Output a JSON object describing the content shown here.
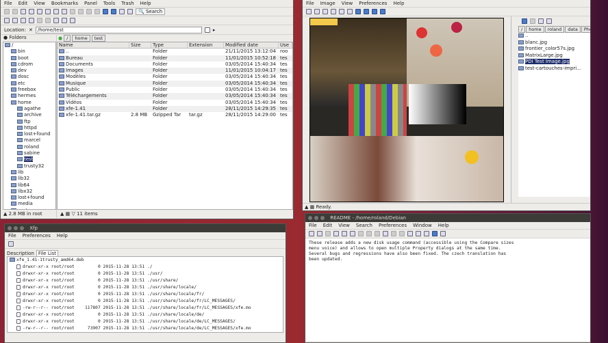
{
  "xfe": {
    "menu": [
      "File",
      "Edit",
      "View",
      "Bookmarks",
      "Panel",
      "Tools",
      "Trash",
      "Help"
    ],
    "search_label": "Search",
    "location_label": "Location:",
    "location_value": "/home/test",
    "folders_label": "Folders",
    "breadcrumb": [
      "/",
      "home",
      "test"
    ],
    "columns": [
      "Name",
      "Size",
      "Type",
      "Extension",
      "Modified date",
      "Use"
    ],
    "rows": [
      {
        "name": "..",
        "size": "",
        "type": "Folder",
        "ext": "",
        "date": "21/11/2015 13:12:04",
        "user": "roo"
      },
      {
        "name": "Bureau",
        "size": "",
        "type": "Folder",
        "ext": "",
        "date": "11/01/2015 10:52:18",
        "user": "tes"
      },
      {
        "name": "Documents",
        "size": "",
        "type": "Folder",
        "ext": "",
        "date": "03/05/2014 15:40:34",
        "user": "tes"
      },
      {
        "name": "Images",
        "size": "",
        "type": "Folder",
        "ext": "",
        "date": "11/01/2015 10:04:17",
        "user": "tes"
      },
      {
        "name": "Modèles",
        "size": "",
        "type": "Folder",
        "ext": "",
        "date": "03/05/2014 15:40:34",
        "user": "tes"
      },
      {
        "name": "Musique",
        "size": "",
        "type": "Folder",
        "ext": "",
        "date": "03/05/2014 15:40:34",
        "user": "tes"
      },
      {
        "name": "Public",
        "size": "",
        "type": "Folder",
        "ext": "",
        "date": "03/05/2014 15:40:34",
        "user": "tes"
      },
      {
        "name": "Téléchargements",
        "size": "",
        "type": "Folder",
        "ext": "",
        "date": "03/05/2014 15:40:34",
        "user": "tes"
      },
      {
        "name": "Vidéos",
        "size": "",
        "type": "Folder",
        "ext": "",
        "date": "03/05/2014 15:40:34",
        "user": "tes"
      },
      {
        "name": "xfe-1.41",
        "size": "",
        "type": "Folder",
        "ext": "",
        "date": "28/11/2015 14:29:35",
        "user": "tes"
      },
      {
        "name": "xfe-1.41.tar.gz",
        "size": "2.8 MB",
        "type": "Gzipped Tar",
        "ext": "tar.gz",
        "date": "28/11/2015 14:29:00",
        "user": "tes"
      }
    ],
    "tree": [
      {
        "label": "/",
        "indent": 0
      },
      {
        "label": "bin",
        "indent": 1
      },
      {
        "label": "boot",
        "indent": 1
      },
      {
        "label": "cdrom",
        "indent": 1
      },
      {
        "label": "dev",
        "indent": 1
      },
      {
        "label": "dosc",
        "indent": 1
      },
      {
        "label": "etc",
        "indent": 1
      },
      {
        "label": "freebox",
        "indent": 1
      },
      {
        "label": "hermes",
        "indent": 1
      },
      {
        "label": "home",
        "indent": 1
      },
      {
        "label": "agathe",
        "indent": 2
      },
      {
        "label": "archive",
        "indent": 2
      },
      {
        "label": "ftp",
        "indent": 2
      },
      {
        "label": "httpd",
        "indent": 2
      },
      {
        "label": "lost+found",
        "indent": 2
      },
      {
        "label": "marcel",
        "indent": 2
      },
      {
        "label": "roland",
        "indent": 2
      },
      {
        "label": "sabine",
        "indent": 2
      },
      {
        "label": "test",
        "indent": 2,
        "selected": true
      },
      {
        "label": "trusty32",
        "indent": 2
      },
      {
        "label": "lib",
        "indent": 1
      },
      {
        "label": "lib32",
        "indent": 1
      },
      {
        "label": "lib64",
        "indent": 1
      },
      {
        "label": "libx32",
        "indent": 1
      },
      {
        "label": "lost+found",
        "indent": 1
      },
      {
        "label": "media",
        "indent": 1
      },
      {
        "label": "mnt",
        "indent": 1
      }
    ],
    "status_left": "2.8 MB in root",
    "status_right": "11 items"
  },
  "viewer": {
    "menu": [
      "File",
      "Image",
      "View",
      "Preferences",
      "Help"
    ],
    "breadcrumb": [
      "/",
      "home",
      "roland",
      "data",
      "Photos"
    ],
    "files": [
      {
        "name": ".."
      },
      {
        "name": "blanc.jpg"
      },
      {
        "name": "frontier_color57s.jpg"
      },
      {
        "name": "MatrixLarge.jpg"
      },
      {
        "name": "PDI Test Image.jpg",
        "selected": true
      },
      {
        "name": "test-cartouches-impri..."
      }
    ],
    "status": "Ready."
  },
  "readme": {
    "title": "README - /home/roland/Debian",
    "menu": [
      "File",
      "Edit",
      "View",
      "Search",
      "Preferences",
      "Window",
      "Help"
    ],
    "lines": [
      "These release adds a new disk usage command (accessible using the Compare sizes",
      "menu voice) and allows to open multiple Property dialogs at the same time.",
      "Several bugs and regressions have also been fixed. The czech translation has",
      "been updated."
    ]
  },
  "xfp": {
    "title": "Xfp",
    "menu": [
      "File",
      "Preferences",
      "Help"
    ],
    "tabs": [
      "Description",
      "File List"
    ],
    "package": "xfe_1.41-1trusty_amd64.deb",
    "entries": [
      "drwxr-xr-x root/root         0 2015-11-28 13:51 ./",
      "drwxr-xr-x root/root         0 2015-11-28 13:51 ./usr/",
      "drwxr-xr-x root/root         0 2015-11-28 13:51 ./usr/share/",
      "drwxr-xr-x root/root         0 2015-11-28 13:51 ./usr/share/locale/",
      "drwxr-xr-x root/root         0 2015-11-28 13:51 ./usr/share/locale/fr/",
      "drwxr-xr-x root/root         0 2015-11-28 13:51 ./usr/share/locale/fr/LC_MESSAGES/",
      "-rw-r--r-- root/root    117807 2015-11-28 13:51 ./usr/share/locale/fr/LC_MESSAGES/xfe.mo",
      "drwxr-xr-x root/root         0 2015-11-28 13:51 ./usr/share/locale/de/",
      "drwxr-xr-x root/root         0 2015-11-28 13:51 ./usr/share/locale/de/LC_MESSAGES/",
      "-rw-r--r-- root/root     73907 2015-11-28 13:51 ./usr/share/locale/de/LC_MESSAGES/xfe.mo"
    ]
  }
}
